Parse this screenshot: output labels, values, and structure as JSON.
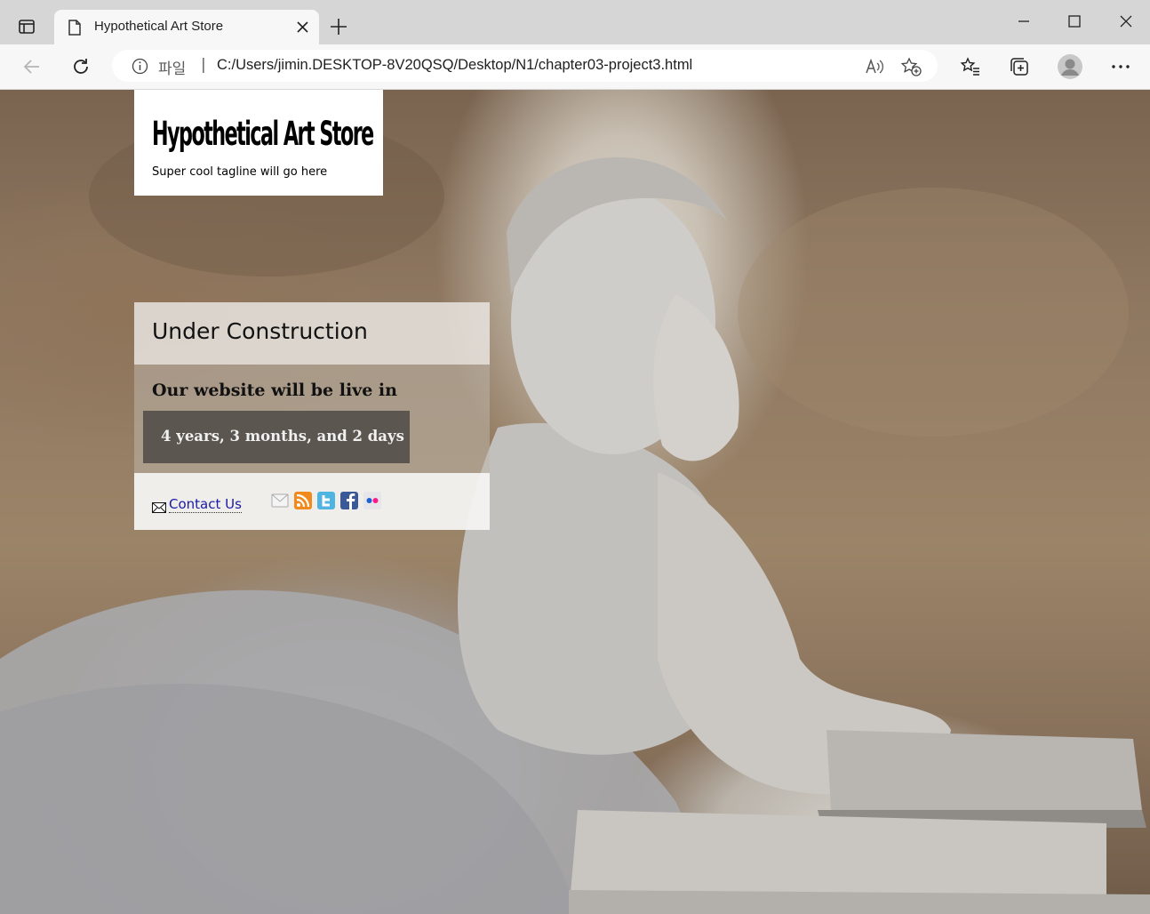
{
  "browser": {
    "tab_title": "Hypothetical Art Store",
    "address_label": "파일",
    "address_separator": "|",
    "url": "C:/Users/jimin.DESKTOP-8V20QSQ/Desktop/N1/chapter03-project3.html"
  },
  "header": {
    "logo": "Hypothetical Art Store",
    "tagline": "Super cool tagline will go here"
  },
  "panel": {
    "heading": "Under Construction",
    "live_text": "Our website will be live in",
    "countdown": "4 years, 3 months, and 2 days",
    "contact_label": "Contact Us",
    "social_icons": [
      "email-icon",
      "rss-icon",
      "twitter-icon",
      "facebook-icon",
      "flickr-icon"
    ]
  },
  "colors": {
    "link": "#1a1aa6",
    "countdown_bg": "#504c48",
    "header_bg": "#ffffff"
  }
}
